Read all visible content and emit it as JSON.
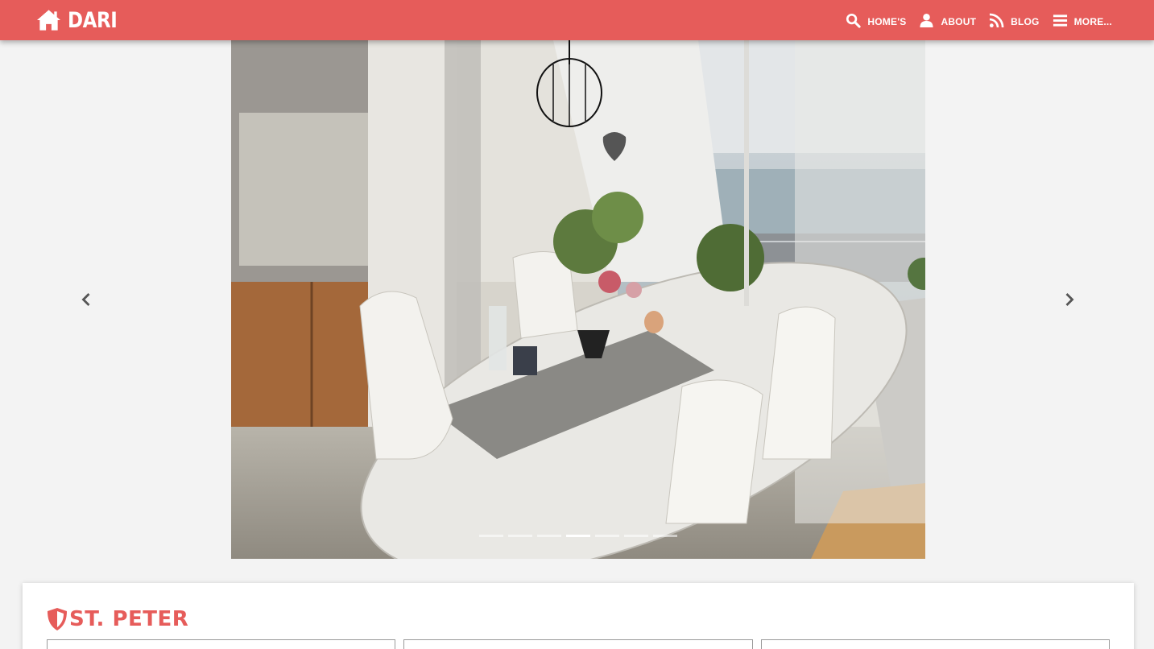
{
  "brand": {
    "name": "DARI",
    "icon": "home-icon"
  },
  "nav": [
    {
      "label": "HOME'S",
      "icon": "search-icon"
    },
    {
      "label": "ABOUT",
      "icon": "user-icon"
    },
    {
      "label": "BLOG",
      "icon": "rss-icon"
    },
    {
      "label": "MORE...",
      "icon": "bars-icon"
    }
  ],
  "carousel": {
    "prev_label": "Previous",
    "next_label": "Next",
    "slide_count": 7,
    "active_index": 3,
    "image_alt": "Dining area with white oval table and chairs beside a balcony with sea view"
  },
  "listing": {
    "title": "ST. PETER",
    "icon": "shield-icon"
  },
  "colors": {
    "accent": "#e65c5a",
    "background": "#f3f3f3"
  }
}
